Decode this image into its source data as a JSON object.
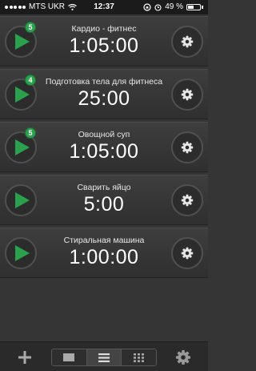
{
  "status_bar": {
    "carrier": "MTS UKR",
    "time": "12:37",
    "battery": "49 %"
  },
  "timers": [
    {
      "title": "Кардио - фитнес",
      "time": "1:05:00",
      "badge": "5"
    },
    {
      "title": "Подготовка тела для фитнеса",
      "time": "25:00",
      "badge": "4"
    },
    {
      "title": "Овощной суп",
      "time": "1:05:00",
      "badge": "5"
    },
    {
      "title": "Сварить яйцо",
      "time": "5:00",
      "badge": null
    },
    {
      "title": "Стиральная машина",
      "time": "1:00:00",
      "badge": null
    }
  ],
  "bottom_bar": {
    "view_modes": [
      "single-view",
      "list-view",
      "grid-view"
    ],
    "selected_view": "list-view"
  },
  "colors": {
    "accent_green": "#2ba14e",
    "background": "#353535"
  }
}
